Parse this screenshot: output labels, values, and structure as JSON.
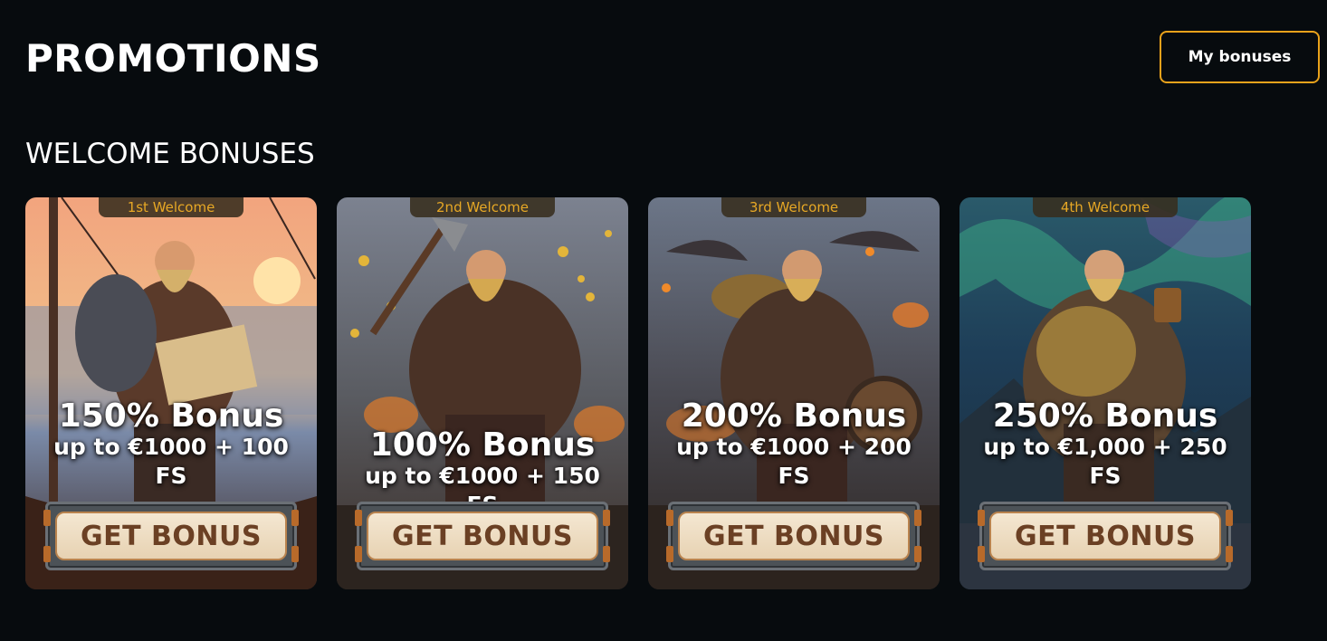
{
  "header": {
    "title": "PROMOTIONS",
    "my_bonuses_label": "My bonuses"
  },
  "section": {
    "title": "WELCOME BONUSES"
  },
  "colors": {
    "accent": "#e9a21b",
    "background": "#070b0e",
    "tag_text": "#e7a825",
    "button_text": "#6b4024"
  },
  "cards": [
    {
      "tag": "1st Welcome",
      "headline": "150% Bonus",
      "subline": "up to €1000 + 100 FS",
      "button": "GET BONUS",
      "scene": "viking-ship-sunset"
    },
    {
      "tag": "2nd Welcome",
      "headline": "100% Bonus",
      "subline": "up to €1000 + 150 FS",
      "button": "GET BONUS",
      "scene": "viking-battle-coins"
    },
    {
      "tag": "3rd Welcome",
      "headline": "200% Bonus",
      "subline": "up to €1000 + 200 FS",
      "button": "GET BONUS",
      "scene": "viking-burning-village"
    },
    {
      "tag": "4th Welcome",
      "headline": "250% Bonus",
      "subline": "up to €1,000 + 250 FS",
      "button": "GET BONUS",
      "scene": "viking-northern-lights"
    }
  ]
}
